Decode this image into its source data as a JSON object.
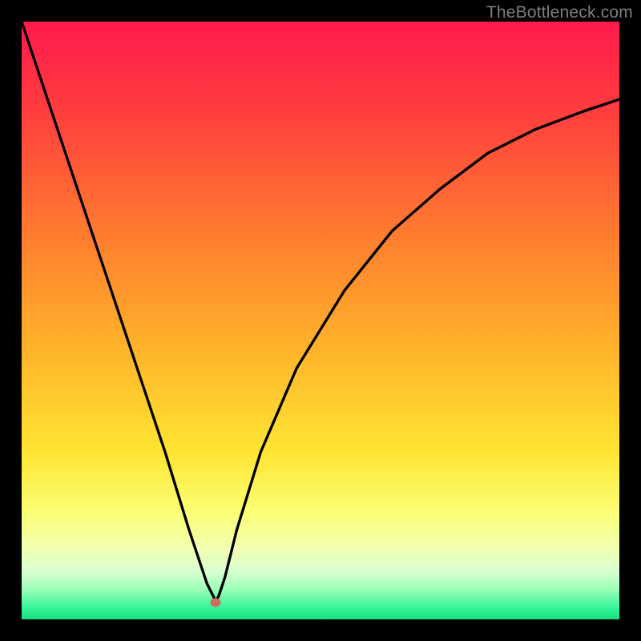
{
  "watermark": "TheBottleneck.com",
  "dot": {
    "x_pct": 32.5,
    "y_pct": 97.2
  },
  "gradient_stops": [
    {
      "pct": 0,
      "color": "#ff1a4d"
    },
    {
      "pct": 14,
      "color": "#ff3b3f"
    },
    {
      "pct": 35,
      "color": "#ff7a2f"
    },
    {
      "pct": 55,
      "color": "#ffb42a"
    },
    {
      "pct": 72,
      "color": "#ffe533"
    },
    {
      "pct": 82,
      "color": "#fbff73"
    },
    {
      "pct": 88,
      "color": "#f2ffb0"
    },
    {
      "pct": 92,
      "color": "#d8ffd0"
    },
    {
      "pct": 95,
      "color": "#9cffb8"
    },
    {
      "pct": 98,
      "color": "#37f59a"
    },
    {
      "pct": 100,
      "color": "#17e07e"
    }
  ],
  "chart_data": {
    "type": "line",
    "title": "",
    "xlabel": "",
    "ylabel": "",
    "xlim": [
      0,
      100
    ],
    "ylim": [
      0,
      100
    ],
    "series": [
      {
        "name": "bottleneck-curve",
        "x": [
          0,
          4,
          8,
          12,
          16,
          20,
          24,
          28,
          30,
          31,
          32,
          32.5,
          33,
          34,
          36,
          40,
          46,
          54,
          62,
          70,
          78,
          86,
          94,
          100
        ],
        "y": [
          100,
          88,
          76,
          64,
          52,
          40,
          28,
          15,
          9,
          6,
          4,
          3,
          4,
          7,
          15,
          28,
          42,
          55,
          65,
          72,
          78,
          82,
          85,
          87
        ]
      }
    ],
    "marker": {
      "x": 32.5,
      "y": 3,
      "color": "#d36a5f"
    },
    "background": "vertical-gradient"
  }
}
